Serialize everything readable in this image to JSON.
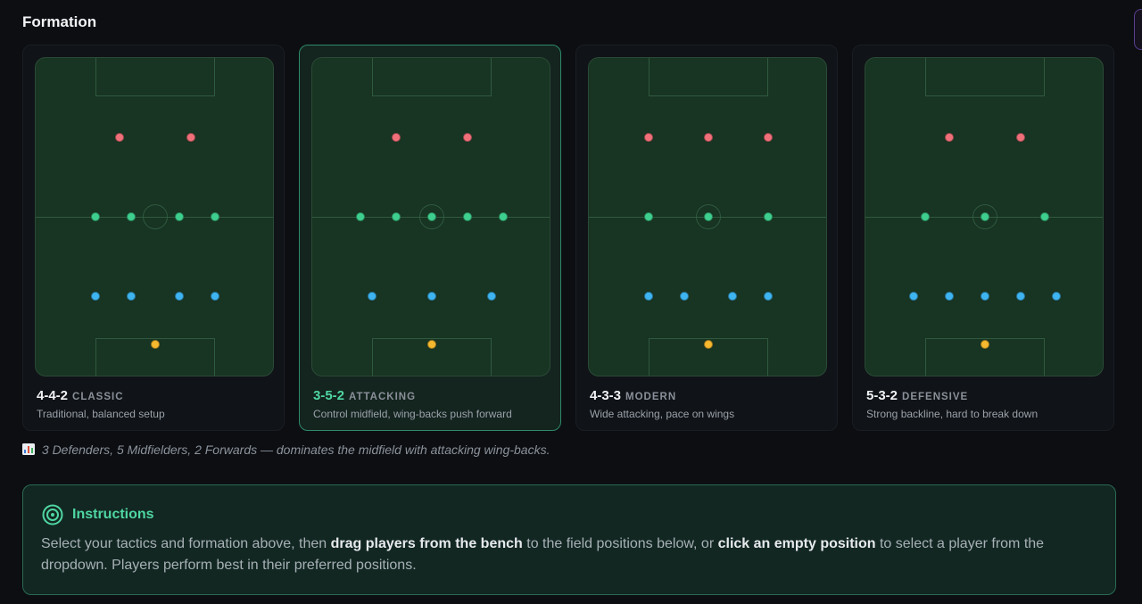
{
  "section": {
    "title": "Formation"
  },
  "colors": {
    "forward": "#f0707a",
    "midfielder": "#3ecf8e",
    "defender": "#3eb4f0",
    "goalkeeper": "#f5b82e",
    "accent": "#4fd6a2"
  },
  "formations": [
    {
      "code": "4-4-2",
      "style": "CLASSIC",
      "description": "Traditional, balanced setup",
      "selected": false,
      "lines": {
        "forwards": 2,
        "midfielders": 4,
        "defenders": 4,
        "goalkeeper": 1
      }
    },
    {
      "code": "3-5-2",
      "style": "ATTACKING",
      "description": "Control midfield, wing-backs push forward",
      "selected": true,
      "lines": {
        "forwards": 2,
        "midfielders": 5,
        "defenders": 3,
        "goalkeeper": 1
      }
    },
    {
      "code": "4-3-3",
      "style": "MODERN",
      "description": "Wide attacking, pace on wings",
      "selected": false,
      "lines": {
        "forwards": 3,
        "midfielders": 3,
        "defenders": 4,
        "goalkeeper": 1
      }
    },
    {
      "code": "5-3-2",
      "style": "DEFENSIVE",
      "description": "Strong backline, hard to break down",
      "selected": false,
      "lines": {
        "forwards": 2,
        "midfielders": 3,
        "defenders": 5,
        "goalkeeper": 1
      }
    }
  ],
  "summary": {
    "icon": "bar-chart-icon",
    "text": "3 Defenders, 5 Midfielders, 2 Forwards — dominates the midfield with attacking wing-backs."
  },
  "instructions": {
    "icon": "target-icon",
    "title": "Instructions",
    "text_1": "Select your tactics and formation above, then ",
    "bold_1": "drag players from the bench",
    "text_2": " to the field positions below, or ",
    "bold_2": "click an empty position",
    "text_3": " to select a player from the dropdown. Players perform best in their preferred positions."
  }
}
